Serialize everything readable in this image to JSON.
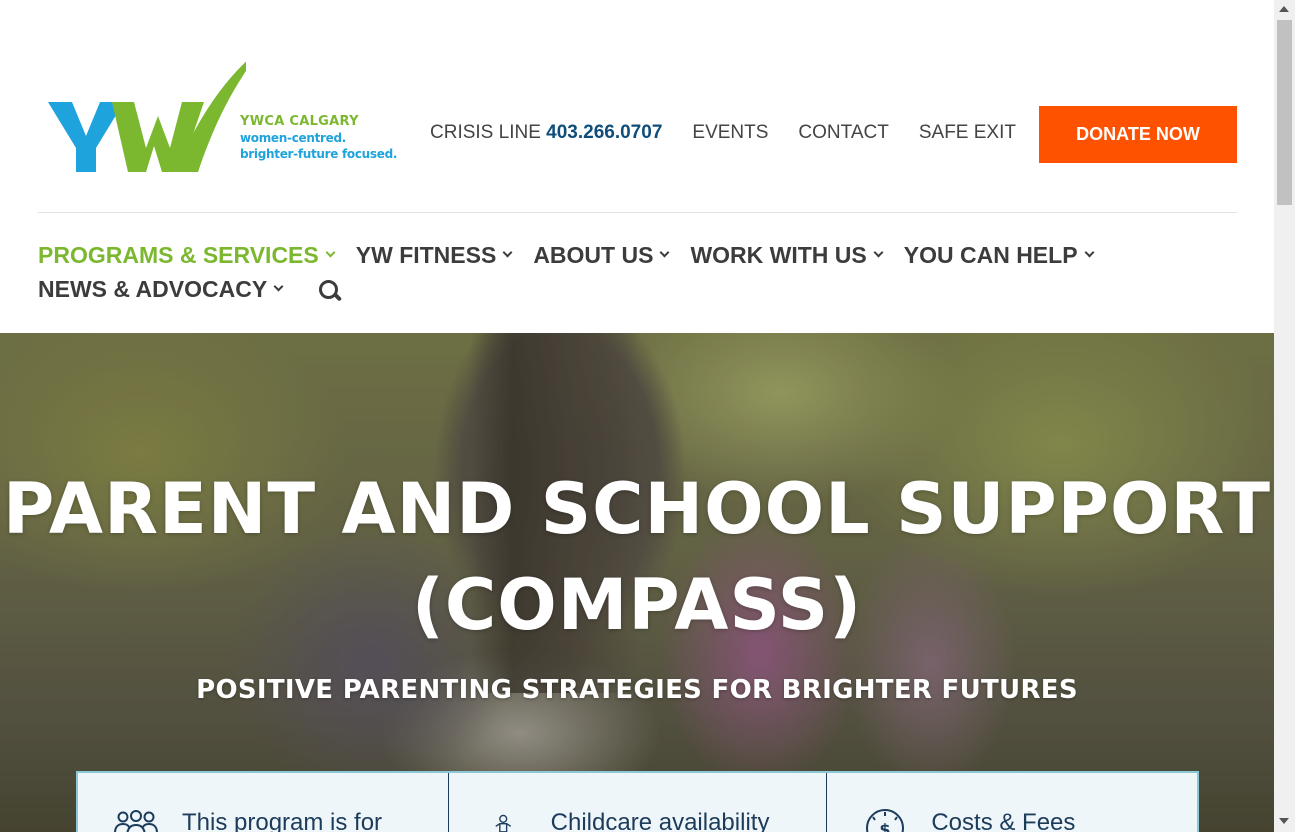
{
  "header": {
    "logo": {
      "org_name": "YWCA CALGARY",
      "tagline_line1": "women-centred.",
      "tagline_line2": "brighter-future focused."
    },
    "crisis_label": "CRISIS LINE",
    "crisis_number": "403.266.0707",
    "top_links": [
      "EVENTS",
      "CONTACT",
      "SAFE EXIT"
    ],
    "donate_label": "DONATE NOW"
  },
  "nav": {
    "items": [
      {
        "label": "PROGRAMS & SERVICES",
        "active": true
      },
      {
        "label": "YW FITNESS"
      },
      {
        "label": "ABOUT US"
      },
      {
        "label": "WORK WITH US"
      },
      {
        "label": "YOU CAN HELP"
      },
      {
        "label": "NEWS & ADVOCACY"
      }
    ]
  },
  "hero": {
    "title_line1": "PARENT AND SCHOOL SUPPORT",
    "title_line2": "(COMPASS)",
    "subtitle": "POSITIVE PARENTING STRATEGIES FOR BRIGHTER FUTURES"
  },
  "info": {
    "columns": [
      {
        "label": "This program is for",
        "icon": "group-icon"
      },
      {
        "label": "Childcare availability",
        "icon": "child-icon"
      },
      {
        "label": "Costs & Fees",
        "icon": "dollar-clock-icon"
      }
    ]
  },
  "colors": {
    "brand_green": "#7cb82f",
    "brand_blue": "#1fa3dd",
    "donate_orange": "#ff5200",
    "crisis_blue": "#0f4d7a"
  }
}
